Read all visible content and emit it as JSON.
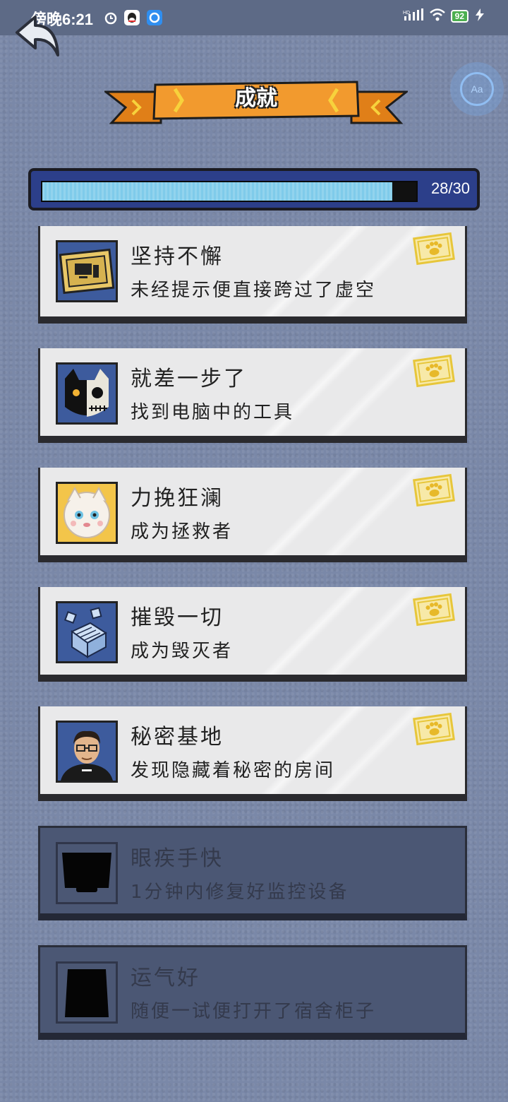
{
  "status_bar": {
    "time": "傍晚6:21",
    "network": "HD",
    "battery": "92"
  },
  "header": {
    "title": "成就"
  },
  "progress": {
    "text": "28/30",
    "fraction": 0.935
  },
  "achievements": [
    {
      "title": "坚持不懈",
      "desc": "未经提示便直接跨过了虚空",
      "icon": "tablet-computer-icon",
      "unlocked": true
    },
    {
      "title": "就差一步了",
      "desc": "找到电脑中的工具",
      "icon": "cat-skull-icon",
      "unlocked": true
    },
    {
      "title": "力挽狂澜",
      "desc": "成为拯救者",
      "icon": "white-cat-icon",
      "unlocked": true
    },
    {
      "title": "摧毁一切",
      "desc": "成为毁灭者",
      "icon": "cube-grid-icon",
      "unlocked": true
    },
    {
      "title": "秘密基地",
      "desc": "发现隐藏着秘密的房间",
      "icon": "man-with-glasses-icon",
      "unlocked": true
    },
    {
      "title": "眼疾手快",
      "desc": "1分钟内修复好监控设备",
      "icon": "monitor-silhouette-icon",
      "unlocked": false
    },
    {
      "title": "运气好",
      "desc": "随便一试便打开了宿舍柜子",
      "icon": "cabinet-silhouette-icon",
      "unlocked": false
    }
  ],
  "colors": {
    "background": "#7a88a8",
    "progress_fill": "#7fcbea",
    "banner": "#f29a2e",
    "stamp": "#f1d24a"
  }
}
